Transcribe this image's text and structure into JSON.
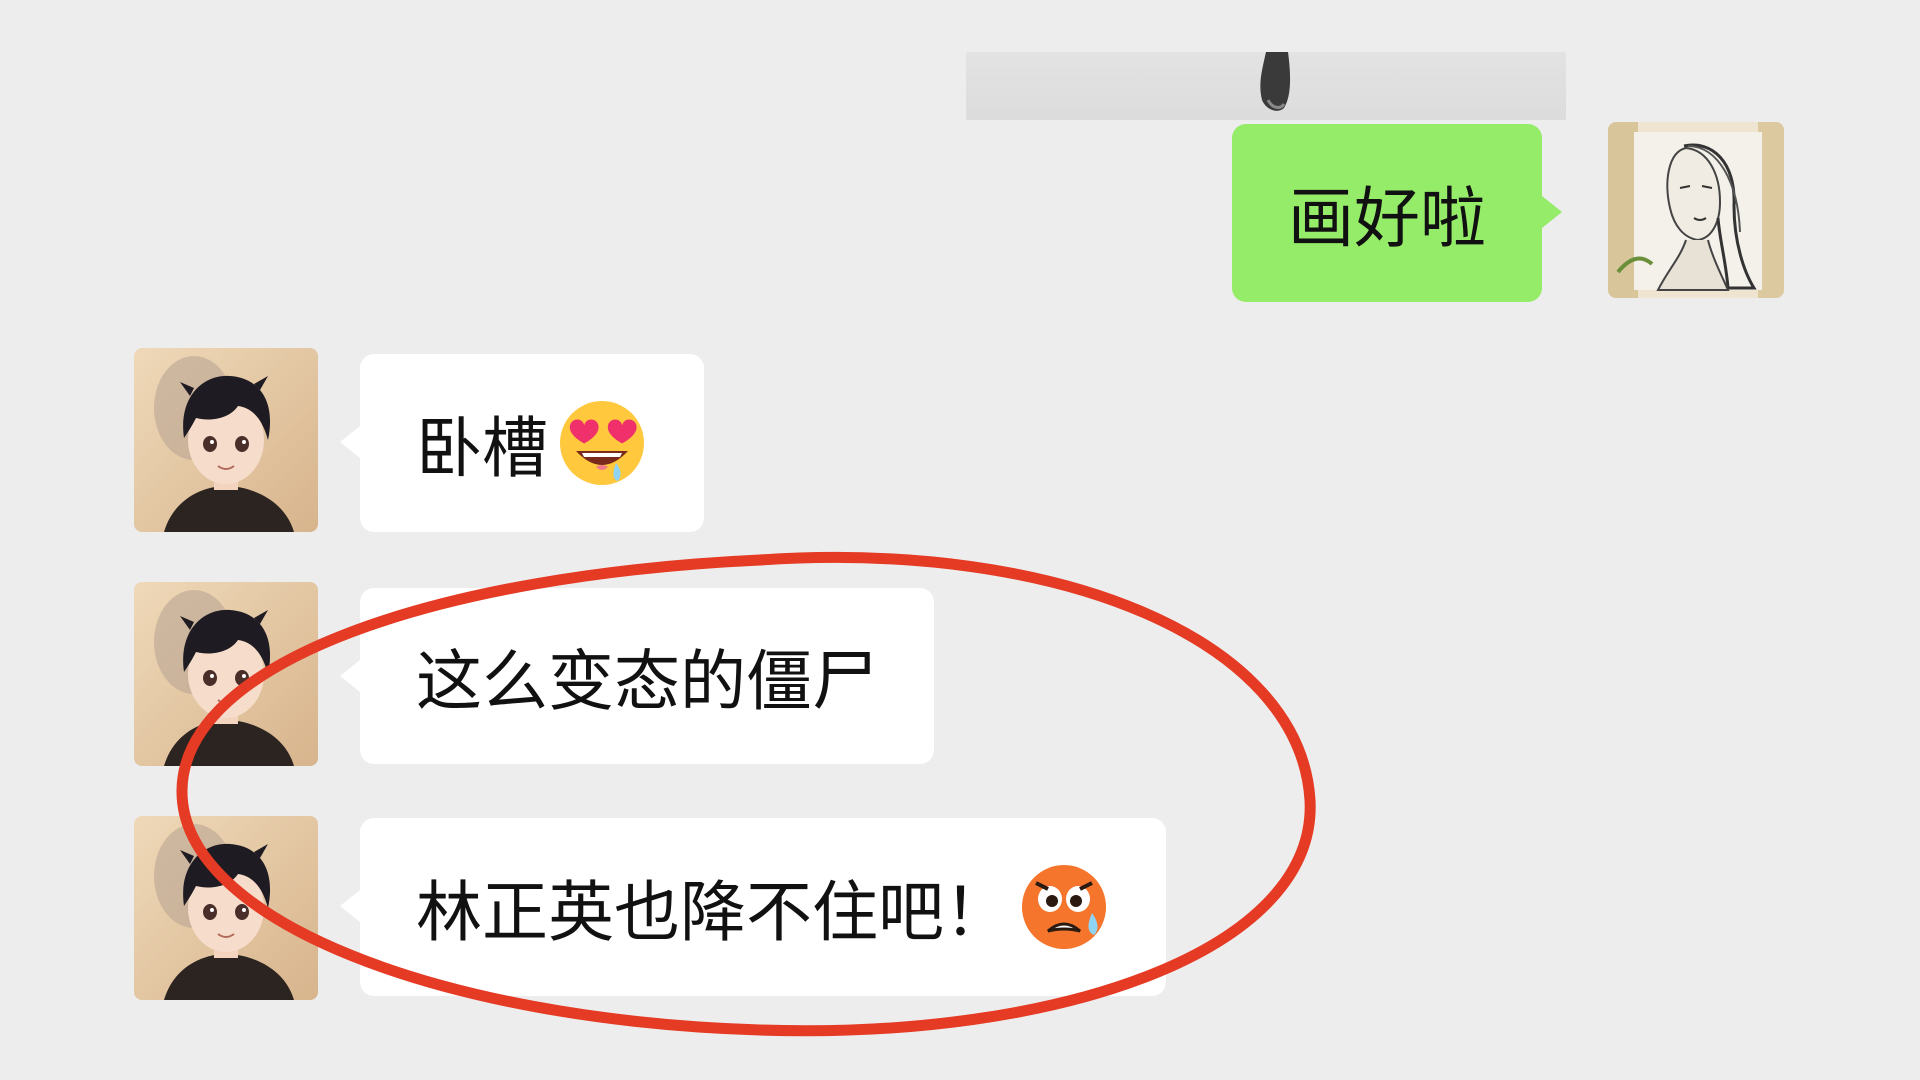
{
  "messages": [
    {
      "id": "m1",
      "direction": "sent",
      "text": "画好啦",
      "emoji": "",
      "avatar": "sketch-portrait-avatar"
    },
    {
      "id": "m2",
      "direction": "received",
      "text": "卧槽",
      "emoji": "heart-eyes-drooling-emoji",
      "avatar": "anime-boy-avatar"
    },
    {
      "id": "m3",
      "direction": "received",
      "text": "这么变态的僵尸",
      "emoji": "",
      "avatar": "anime-boy-avatar"
    },
    {
      "id": "m4",
      "direction": "received",
      "text": "林正英也降不住吧！",
      "emoji": "worried-sweat-emoji",
      "avatar": "anime-boy-avatar"
    }
  ],
  "colors": {
    "background": "#ededed",
    "sent_bubble": "#95ec69",
    "received_bubble": "#ffffff",
    "highlight": "#e53a24"
  }
}
